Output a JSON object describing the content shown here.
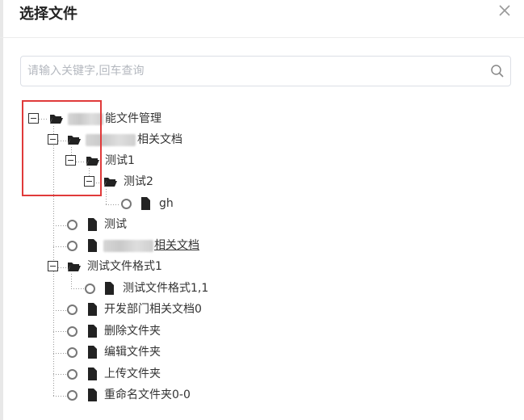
{
  "dialog": {
    "title": "选择文件"
  },
  "search": {
    "placeholder": "请输入关键字,回车查询"
  },
  "tree": {
    "root_label": "能文件管理",
    "child_label": "相关文档",
    "test1_label": "测试1",
    "test2_label": "测试2",
    "gh_label": "gh",
    "test_label": "测试",
    "related_doc_label": "相关文档",
    "format_folder_label": "测试文件格式1",
    "format_file_label": "测试文件格式1,1",
    "dev_doc_label": "开发部门相关文档0",
    "delete_folder_label": "删除文件夹",
    "edit_folder_label": "编辑文件夹",
    "upload_folder_label": "上传文件夹",
    "rename_folder_label": "重命名文件夹0-0"
  },
  "colors": {
    "highlight": "#e03a3a",
    "text": "#333333",
    "border": "#dcdfe6"
  }
}
